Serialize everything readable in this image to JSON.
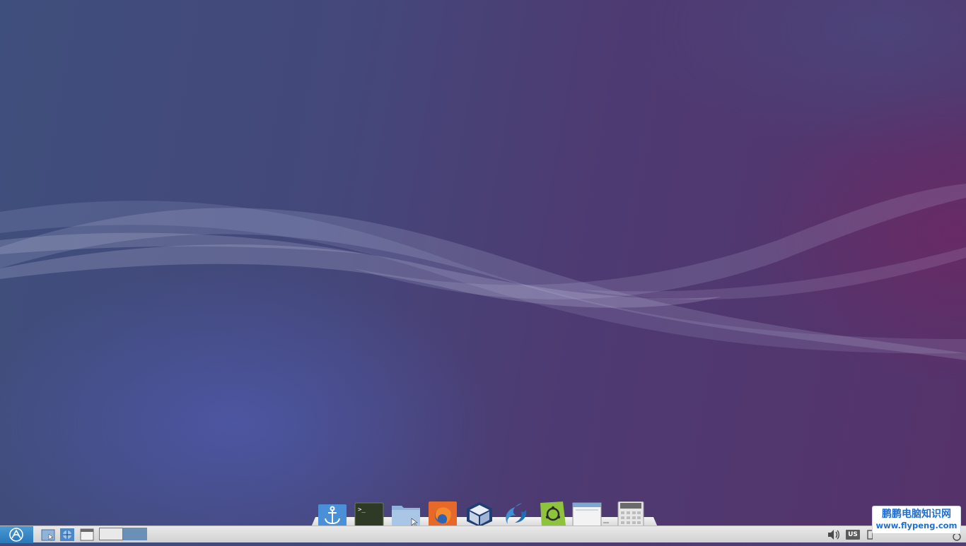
{
  "desktop": {
    "wallpaper": "purple-blue waves"
  },
  "dock": {
    "items": [
      {
        "name": "anchor-icon"
      },
      {
        "name": "terminal-icon"
      },
      {
        "name": "file-manager-icon"
      },
      {
        "name": "firefox-icon"
      },
      {
        "name": "virtualbox-icon"
      },
      {
        "name": "lxqt-swirl-icon"
      },
      {
        "name": "software-center-icon"
      },
      {
        "name": "window-app-icon"
      },
      {
        "name": "calculator-icon"
      }
    ]
  },
  "taskbar": {
    "start_icon": "lxqt-logo-icon",
    "quicklaunch": [
      "show-desktop-icon",
      "network-icon",
      "window-icon"
    ],
    "workspaces": [
      {
        "state": "inactive"
      },
      {
        "state": "active"
      }
    ],
    "tray": {
      "volume_icon": "speaker-icon",
      "keyboard_layout": "US"
    }
  },
  "watermark": {
    "line1": "鹏鹏电脑知识网",
    "line2": "www.flypeng.com"
  },
  "colors": {
    "wallpaper_left": "#3f4f7d",
    "wallpaper_right": "#56326a",
    "start_button": "#2a78b8",
    "taskbar": "#e0e0e0",
    "active_workspace": "#6c8fb5",
    "watermark_text": "#1e6fd0"
  }
}
